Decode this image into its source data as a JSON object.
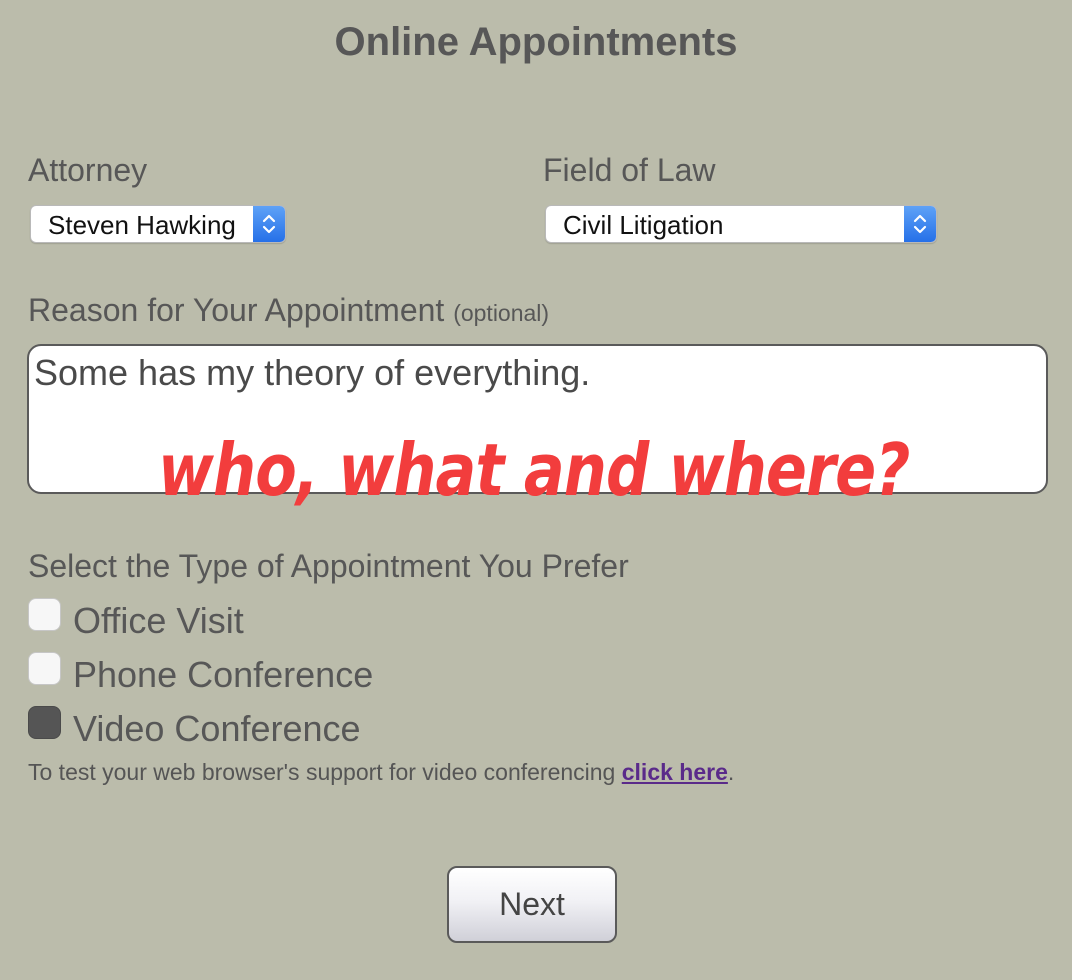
{
  "header": {
    "title": "Online Appointments"
  },
  "attorney": {
    "label": "Attorney",
    "selected": "Steven Hawking"
  },
  "field_of_law": {
    "label": "Field of Law",
    "selected": "Civil Litigation"
  },
  "reason": {
    "label": "Reason for Your Appointment",
    "optional_note": "(optional)",
    "value": "Some has my theory of everything."
  },
  "annotation": {
    "text": "who, what and where?",
    "color": "#f23d3d"
  },
  "appointment_type": {
    "label": "Select the Type of Appointment You Prefer",
    "options": [
      {
        "label": "Office Visit",
        "checked": false
      },
      {
        "label": "Phone Conference",
        "checked": false
      },
      {
        "label": "Video Conference",
        "checked": true
      }
    ]
  },
  "video_test": {
    "text": "To test your web browser's support for video conferencing ",
    "link": "click here",
    "suffix": "."
  },
  "actions": {
    "next_label": "Next"
  },
  "colors": {
    "background": "#bbbcab",
    "select_accent": "#2670e8",
    "link": "#5a2a8a"
  }
}
